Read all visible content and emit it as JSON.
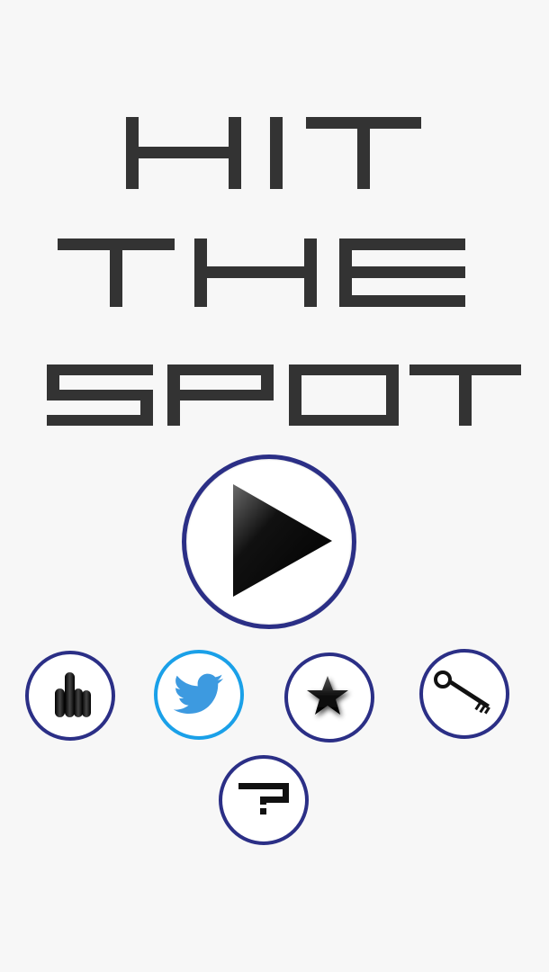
{
  "title": {
    "line1": "HIT",
    "line2": "THE",
    "line3": "SPOT"
  },
  "buttons": {
    "play": {
      "icon": "play-icon"
    },
    "rate": {
      "icon": "hand-icon"
    },
    "twitter": {
      "icon": "twitter-bird-icon",
      "color": "#1aa0e8"
    },
    "star": {
      "icon": "star-icon"
    },
    "key": {
      "icon": "key-icon"
    },
    "help": {
      "icon": "question-mark-icon"
    }
  },
  "colors": {
    "background": "#f7f7f7",
    "title": "#333333",
    "ring": "#2b2f86",
    "twitter_ring": "#1aa0e8"
  }
}
